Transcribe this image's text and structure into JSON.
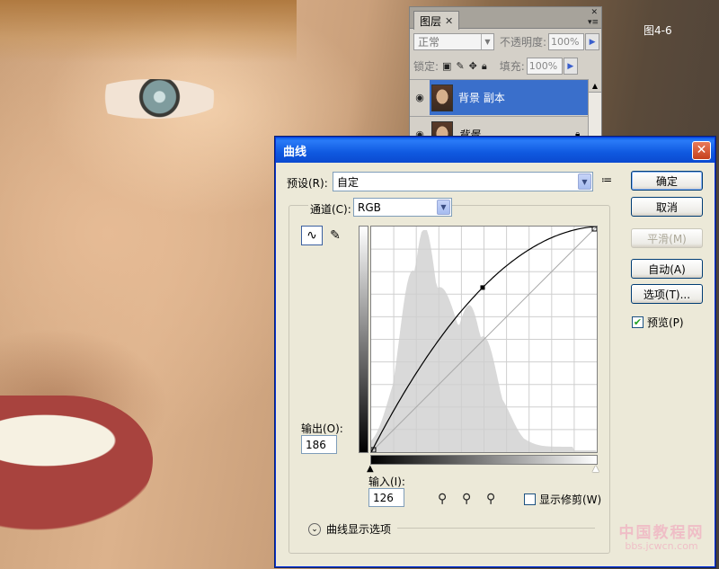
{
  "figure_label": "图4-6",
  "watermark": {
    "title": "中国教程网",
    "url": "bbs.jcwcn.com"
  },
  "layers_panel": {
    "tab_label": "图层",
    "blend_mode": "正常",
    "opacity_label": "不透明度:",
    "opacity_value": "100%",
    "lock_label": "锁定:",
    "fill_label": "填充:",
    "fill_value": "100%",
    "layers": [
      {
        "name": "背景 副本",
        "selected": true
      },
      {
        "name": "背景",
        "selected": false,
        "locked": true
      }
    ],
    "icons": [
      "eye-icon",
      "lock-icon",
      "close-icon",
      "menu-icon"
    ]
  },
  "curves_dialog": {
    "title": "曲线",
    "preset_label": "预设(R):",
    "preset_value": "自定",
    "channel_label": "通道(C):",
    "channel_value": "RGB",
    "buttons": {
      "ok": "确定",
      "cancel": "取消",
      "smooth": "平滑(M)",
      "auto": "自动(A)",
      "options": "选项(T)..."
    },
    "preview_label": "预览(P)",
    "preview_checked": true,
    "output_label": "输出(O):",
    "output_value": "186",
    "input_label": "输入(I):",
    "input_value": "126",
    "show_clipping_label": "显示修剪(W)",
    "show_clipping_checked": false,
    "curve_options_label": "曲线显示选项",
    "control_point": {
      "input": 126,
      "output": 186
    },
    "accent_color": "#0b4ad0"
  }
}
